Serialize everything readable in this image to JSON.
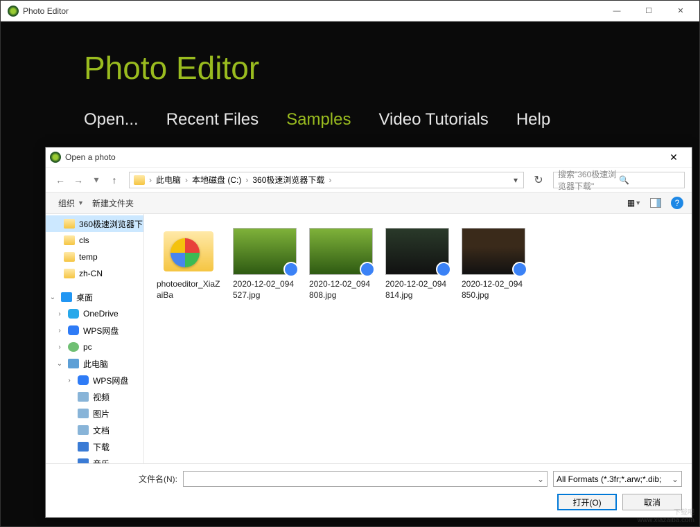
{
  "app": {
    "title": "Photo Editor",
    "heading": "Photo Editor",
    "tabs": {
      "open": "Open...",
      "recent": "Recent Files",
      "samples": "Samples",
      "video": "Video Tutorials",
      "help": "Help"
    },
    "win": {
      "min": "—",
      "max": "☐",
      "close": "✕"
    }
  },
  "dialog": {
    "title": "Open a photo",
    "close": "✕",
    "nav": {
      "back": "←",
      "fwd": "→",
      "dd": "▾",
      "up": "↑",
      "refresh": "↻"
    },
    "breadcrumb": {
      "sep": "›",
      "pc": "此电脑",
      "drive": "本地磁盘 (C:)",
      "folder": "360极速浏览器下载"
    },
    "search_placeholder": "搜索\"360极速浏览器下载\"",
    "toolbar": {
      "organize": "组织",
      "newfolder": "新建文件夹"
    },
    "tree": {
      "sel": "360极速浏览器下",
      "cls": "cls",
      "temp": "temp",
      "zhcn": "zh-CN",
      "desktop": "桌面",
      "onedrive": "OneDrive",
      "wps": "WPS网盘",
      "pc": "pc",
      "thispc": "此电脑",
      "wps2": "WPS网盘",
      "video": "视频",
      "pictures": "图片",
      "docs": "文档",
      "downloads": "下载",
      "music": "音乐"
    },
    "files": {
      "f0": "photoeditor_XiaZaiBa",
      "f1": "2020-12-02_094527.jpg",
      "f2": "2020-12-02_094808.jpg",
      "f3": "2020-12-02_094814.jpg",
      "f4": "2020-12-02_094850.jpg"
    },
    "filename_label": "文件名(N):",
    "filter": "All Formats (*.3fr;*.arw;*.dib;",
    "open_btn": "打开(O)",
    "cancel_btn": "取消"
  },
  "watermark": {
    "l1": "下载吧",
    "l2": "www.xiazaiba.com"
  }
}
